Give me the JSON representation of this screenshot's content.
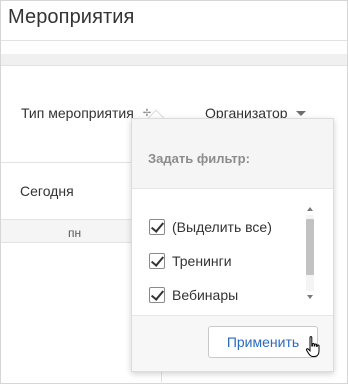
{
  "page": {
    "title": "Мероприятия"
  },
  "filters": {
    "type_label": "Тип мероприятия",
    "organizer_label": "Организатор"
  },
  "calendar": {
    "today_label": "Сегодня",
    "day_label": "пн"
  },
  "popup": {
    "title": "Задать фильтр:",
    "items": [
      {
        "label": "(Выделить все)",
        "checked": true
      },
      {
        "label": "Тренинги",
        "checked": true
      },
      {
        "label": "Вебинары",
        "checked": true
      }
    ],
    "apply_label": "Применить"
  },
  "icons": {
    "type_filter": "filter-icon",
    "organizer_dropdown": "caret-down-icon",
    "cursor": "hand-pointer-icon"
  },
  "colors": {
    "accent": "#2b6bbd",
    "muted_text": "#8c8c8c",
    "panel_bg": "#f5f5f5"
  }
}
